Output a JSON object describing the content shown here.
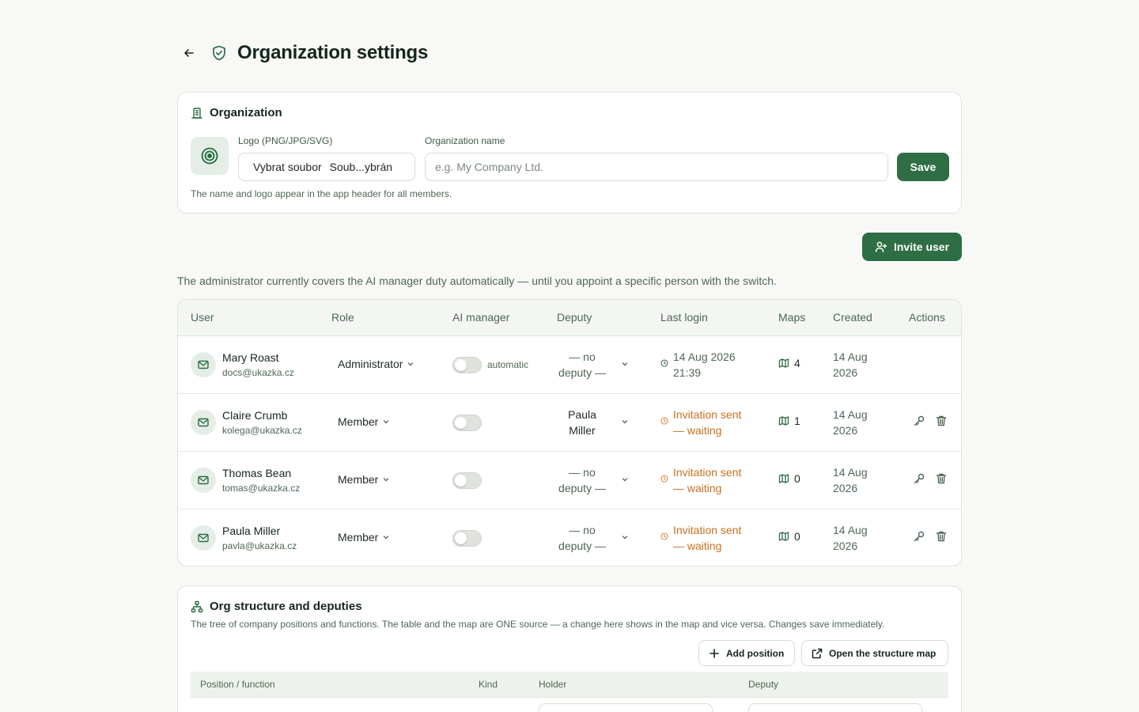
{
  "page": {
    "title": "Organization settings"
  },
  "organization": {
    "heading": "Organization",
    "logo_label": "Logo (PNG/JPG/SVG)",
    "file_button": "Vybrat soubor",
    "file_status": "Soub...ybrán",
    "name_label": "Organization name",
    "name_value": "",
    "name_placeholder": "e.g. My Company Ltd.",
    "save_label": "Save",
    "hint": "The name and logo appear in the app header for all members."
  },
  "invite_label": "Invite user",
  "admin_note": "The administrator currently covers the AI manager duty automatically — until you appoint a specific person with the switch.",
  "users_table": {
    "columns": [
      "User",
      "Role",
      "AI manager",
      "Deputy",
      "Last login",
      "Maps",
      "Created",
      "Actions"
    ],
    "rows": [
      {
        "name": "Mary Roast",
        "email": "docs@ukazka.cz",
        "role": "Administrator",
        "ai_manager_on": false,
        "ai_manager_note": "automatic",
        "deputy_line1": "— no",
        "deputy_line2": "deputy —",
        "login_line1": "14 Aug 2026",
        "login_line2": "21:39",
        "login_status": "ok",
        "maps": "4",
        "created_line1": "14 Aug",
        "created_line2": "2026",
        "has_actions": false
      },
      {
        "name": "Claire Crumb",
        "email": "kolega@ukazka.cz",
        "role": "Member",
        "ai_manager_on": false,
        "ai_manager_note": "",
        "deputy_line1": "Paula",
        "deputy_line2": "Miller",
        "login_line1": "Invitation sent",
        "login_line2": "— waiting",
        "login_status": "waiting",
        "maps": "1",
        "created_line1": "14 Aug",
        "created_line2": "2026",
        "has_actions": true
      },
      {
        "name": "Thomas Bean",
        "email": "tomas@ukazka.cz",
        "role": "Member",
        "ai_manager_on": false,
        "ai_manager_note": "",
        "deputy_line1": "— no",
        "deputy_line2": "deputy —",
        "login_line1": "Invitation sent",
        "login_line2": "— waiting",
        "login_status": "waiting",
        "maps": "0",
        "created_line1": "14 Aug",
        "created_line2": "2026",
        "has_actions": true
      },
      {
        "name": "Paula Miller",
        "email": "pavla@ukazka.cz",
        "role": "Member",
        "ai_manager_on": false,
        "ai_manager_note": "",
        "deputy_line1": "— no",
        "deputy_line2": "deputy —",
        "login_line1": "Invitation sent",
        "login_line2": "— waiting",
        "login_status": "waiting",
        "maps": "0",
        "created_line1": "14 Aug",
        "created_line2": "2026",
        "has_actions": true
      }
    ]
  },
  "structure": {
    "heading": "Org structure and deputies",
    "description": "The tree of company positions and functions. The table and the map are ONE source — a change here shows in the map and vice versa. Changes save immediately.",
    "add_position_label": "Add position",
    "open_map_label": "Open the structure map",
    "columns": [
      "Position / function",
      "Kind",
      "Holder",
      "Deputy"
    ]
  },
  "colors": {
    "accent": "#2e6e44",
    "waiting": "#c8701f",
    "background": "#f8f9f7"
  },
  "icons": [
    "arrow-left-icon",
    "shield-check-icon",
    "building-icon",
    "target-logo-icon",
    "user-plus-icon",
    "mail-icon",
    "chevron-down-icon",
    "clock-icon",
    "map-icon",
    "key-icon",
    "trash-icon",
    "sitemap-icon",
    "plus-icon",
    "external-link-icon"
  ]
}
